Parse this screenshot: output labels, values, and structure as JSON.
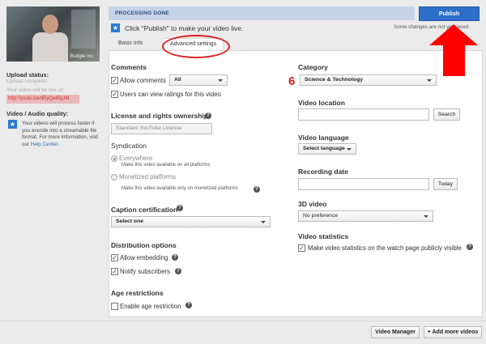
{
  "thumbnail": {
    "caption": "Budgie Inc"
  },
  "left": {
    "upload_status_label": "Upload status:",
    "upload_status_value": "Upload complete!",
    "live_label": "Your video will be live at:",
    "video_url": "http://youtu.be/dRyQatBgJM",
    "quality_label": "Video / Audio quality:",
    "quality_text": "Your videos will process faster if you encode into a streamable file format. For more information, visit our",
    "help_center": "Help Center",
    "help_center_suffix": "."
  },
  "header": {
    "status_banner": "PROCESSING DONE",
    "publish_label": "Publish",
    "publish_hint": "Click \"Publish\" to make your video live.",
    "saved_note": "Some changes are not yet saved."
  },
  "tabs": [
    {
      "label": "Basic info"
    },
    {
      "label": "Advanced settings"
    }
  ],
  "annotation": {
    "step_number": "6"
  },
  "settings": {
    "comments": {
      "title": "Comments",
      "allow_label": "Allow comments",
      "allow_value": "All",
      "ratings_label": "Users can view ratings for this video"
    },
    "license": {
      "title": "License and rights ownership",
      "value": "Standard YouTube License"
    },
    "syndication": {
      "title": "Syndication",
      "everywhere_label": "Everywhere",
      "everywhere_desc": "Make this video available on all platforms",
      "monetized_label": "Monetized platforms",
      "monetized_desc": "Make this video available only on monetized platforms"
    },
    "caption": {
      "title": "Caption certification",
      "value": "Select one"
    },
    "distribution": {
      "title": "Distribution options",
      "embedding_label": "Allow embedding",
      "notify_label": "Notify subscribers"
    },
    "age": {
      "title": "Age restrictions",
      "enable_label": "Enable age restriction"
    },
    "category": {
      "title": "Category",
      "value": "Science & Technology"
    },
    "location": {
      "title": "Video location",
      "search_label": "Search"
    },
    "language": {
      "title": "Video language",
      "value": "Select language"
    },
    "recording": {
      "title": "Recording date",
      "today_label": "Today"
    },
    "video3d": {
      "title": "3D video",
      "value": "No preference"
    },
    "statistics": {
      "title": "Video statistics",
      "label": "Make video statistics on the watch page publicly visible"
    }
  },
  "footer": {
    "video_manager": "Video Manager",
    "add_more": "+ Add more videos"
  },
  "colors": {
    "accent": "#2d6ec9",
    "annotation_red": "#ff0000",
    "banner": "#c7d3e6"
  },
  "icons": {
    "info": "info-icon",
    "help": "help-icon",
    "arrow": "red-arrow-up"
  }
}
